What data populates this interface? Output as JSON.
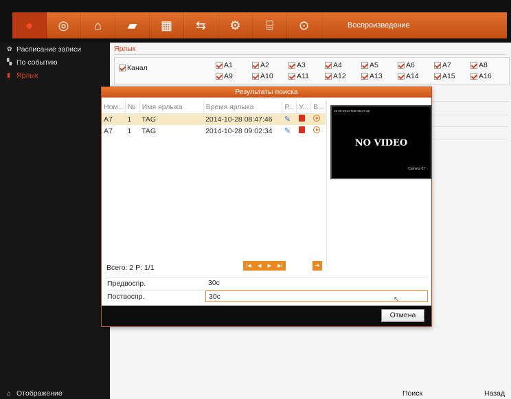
{
  "topbar": {
    "title": "Воспроизведение",
    "icons": [
      "camera-record-icon",
      "playback-icon",
      "camera-settings-icon",
      "hdd-icon",
      "record-config-icon",
      "network-icon",
      "config-icon",
      "account-icon",
      "shutdown-icon"
    ]
  },
  "sidebar": {
    "items": [
      {
        "label": "Расписание записи",
        "icon": "gear-icon"
      },
      {
        "label": "По событию",
        "icon": "event-icon"
      },
      {
        "label": "Ярлык",
        "icon": "tag-icon"
      }
    ],
    "bottom_label": "Отображение"
  },
  "main": {
    "section_title": "Ярлык",
    "channel_label": "Канал",
    "channels_row1": [
      "A1",
      "A2",
      "A3",
      "A4",
      "A5",
      "A6",
      "A7",
      "A8"
    ],
    "channels_row2": [
      "A9",
      "A10",
      "A11",
      "A12",
      "A13",
      "A14",
      "A15",
      "A16"
    ],
    "search_label": "Поиск",
    "back_label": "Назад"
  },
  "dialog": {
    "title": "Результаты поиска",
    "columns": [
      "Ном...",
      "№",
      "Имя ярлыка",
      "Время ярлыка",
      "Р...",
      "У...",
      "В..."
    ],
    "rows": [
      {
        "cam": "A7",
        "no": "1",
        "name": "TAG",
        "time": "2014-10-28 08:47:46"
      },
      {
        "cam": "A7",
        "no": "1",
        "name": "TAG",
        "time": "2014-10-28 09:02:34"
      }
    ],
    "preview": {
      "stamp": "10-28-2014 TUE 08:47:46",
      "text": "NO VIDEO",
      "camera": "Camera 07"
    },
    "total": "Всего: 2  P: 1/1",
    "pager": [
      "|◀",
      "◀",
      "▶",
      "▶|"
    ],
    "goto": "➜",
    "pre_label": "Предвоспр.",
    "pre_value": "30с",
    "post_label": "Поствоспр.",
    "post_value": "30с",
    "cancel": "Отмена"
  }
}
